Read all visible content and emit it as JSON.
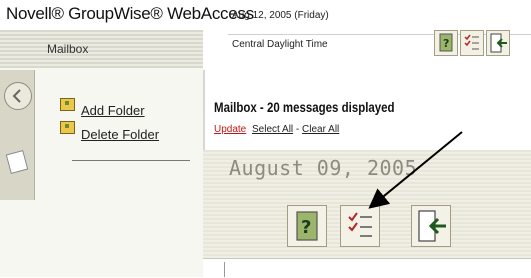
{
  "header": {
    "brand": "Novell® GroupWise® WebAccess",
    "date": "Aug 12, 2005 (Friday)",
    "timezone": "Central Daylight Time",
    "section_label": "Mailbox",
    "toolbar_icons": [
      "help-icon",
      "options-icon",
      "exit-icon"
    ]
  },
  "sidebar": {
    "items": [
      {
        "label": "Add Folder",
        "icon": "add-folder-icon"
      },
      {
        "label": "Delete Folder",
        "icon": "delete-folder-icon"
      }
    ]
  },
  "main": {
    "title": "Mailbox - 20 messages displayed",
    "update": "Update",
    "select_all": "Select All",
    "separator": "-",
    "clear_all": "Clear All"
  },
  "zoom_callout": {
    "date": "August 09, 2005",
    "icons": [
      "help-icon",
      "options-icon",
      "exit-icon"
    ]
  },
  "colors": {
    "accent_red": "#c41818",
    "stripe": "#d8d8cc",
    "folder": "#e9c84c"
  }
}
